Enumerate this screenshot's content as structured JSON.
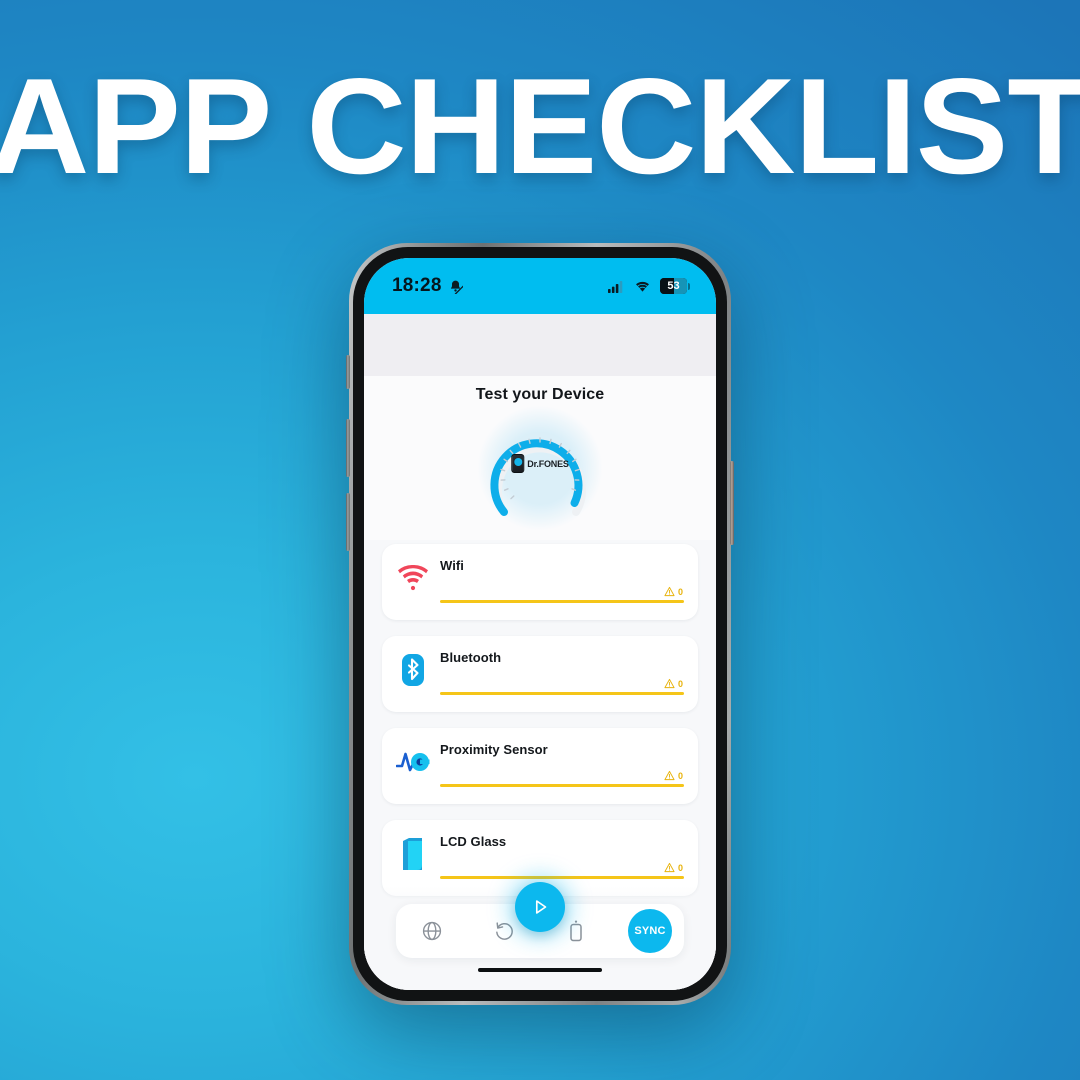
{
  "poster": {
    "title": "APP CHECKLIST",
    "background_color_light": "#33c0e6",
    "background_color_dark": "#1c75b8"
  },
  "phone": {
    "statusbar": {
      "time": "18:28",
      "mute_icon": "bell-slash-icon",
      "signal_icon": "cellular-signal-icon",
      "wifi_icon": "wifi-status-icon",
      "battery_level": "53",
      "background_color": "#00bdf0"
    },
    "screen": {
      "gauge": {
        "title": "Test your Device",
        "logo_text": "Dr.FONES",
        "arc_color": "#0eaeea",
        "arc_track_color": "#eef1f4"
      },
      "checklist": [
        {
          "label": "Wifi",
          "icon": "wifi-icon",
          "icon_color": "#f0465a",
          "warning_icon": "warning-triangle-icon",
          "count": "0",
          "meter_color": "#f5c518"
        },
        {
          "label": "Bluetooth",
          "icon": "bluetooth-icon",
          "icon_color": "#11a6e4",
          "warning_icon": "warning-triangle-icon",
          "count": "0",
          "meter_color": "#f5c518"
        },
        {
          "label": "Proximity Sensor",
          "icon": "proximity-sensor-icon",
          "icon_color": "#1a5fd0",
          "warning_icon": "warning-triangle-icon",
          "count": "0",
          "meter_color": "#f5c518"
        },
        {
          "label": "LCD Glass",
          "icon": "lcd-glass-icon",
          "icon_color": "#22d3f5",
          "warning_icon": "warning-triangle-icon",
          "count": "0",
          "meter_color": "#f5c518"
        }
      ],
      "bottom_nav": {
        "globe": "globe-icon",
        "reset": "reset-arrow-icon",
        "play": "play-icon",
        "device": "device-icon",
        "sync_label": "SYNC",
        "accent_color": "#0cb8ee"
      }
    }
  }
}
